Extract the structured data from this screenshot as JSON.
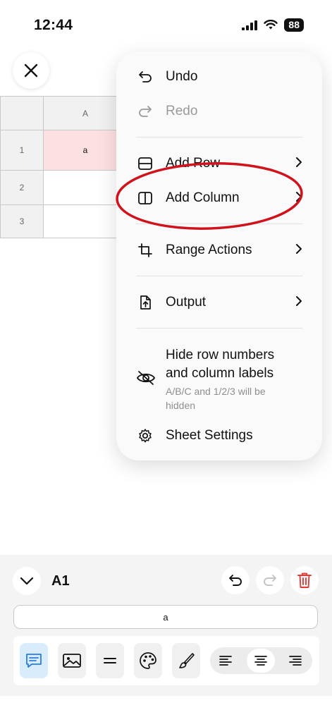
{
  "status_bar": {
    "time": "12:44",
    "battery": "88"
  },
  "grid": {
    "column_headers": [
      "A"
    ],
    "row_headers": [
      "1",
      "2",
      "3"
    ],
    "cells": [
      [
        "a"
      ],
      [
        ""
      ],
      [
        ""
      ]
    ]
  },
  "menu": {
    "undo": "Undo",
    "redo": "Redo",
    "add_row": "Add Row",
    "add_column": "Add Column",
    "range_actions": "Range Actions",
    "output": "Output",
    "hide_labels": "Hide row numbers and column labels",
    "hide_labels_sub": "A/B/C and 1/2/3 will be hidden",
    "sheet_settings": "Sheet Settings"
  },
  "editor": {
    "cell_ref": "A1",
    "formula_value": "a"
  },
  "colors": {
    "selected_cell": "#fde0e2",
    "annotation_red": "#d0121c",
    "delete_red": "#e53935",
    "active_blue": "#2a7de1"
  }
}
